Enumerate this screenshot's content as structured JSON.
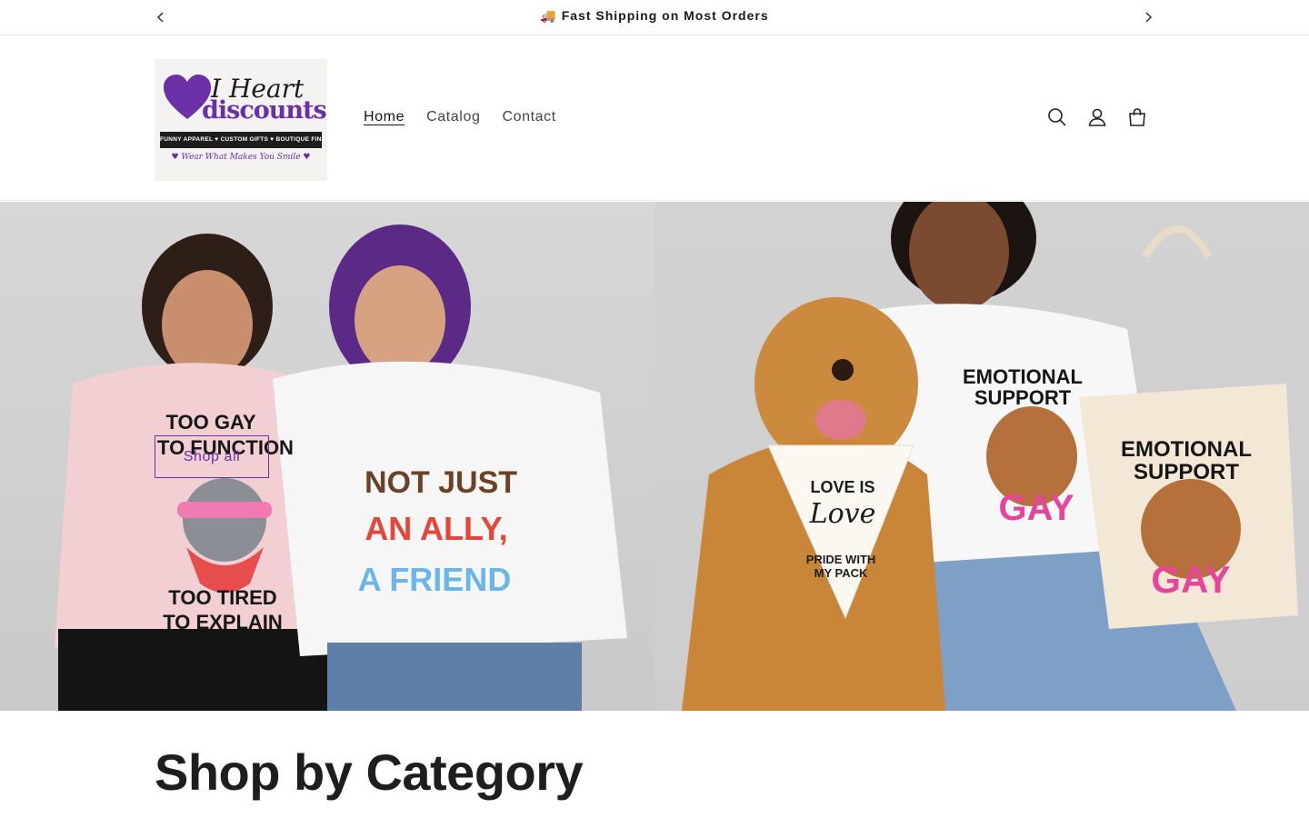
{
  "announcement": {
    "text": "🚚 Fast Shipping on Most Orders",
    "prev_icon": "chevron-left-icon",
    "next_icon": "chevron-right-icon"
  },
  "header": {
    "logo": {
      "line1": "I Heart",
      "line2": "discounts",
      "ribbon": "FUNNY APPAREL ♥ CUSTOM GIFTS ♥ BOUTIQUE FINDS",
      "tagline": "♥ Wear What Makes You Smile ♥"
    },
    "nav": [
      {
        "label": "Home",
        "active": true
      },
      {
        "label": "Catalog",
        "active": false
      },
      {
        "label": "Contact",
        "active": false
      }
    ],
    "icons": [
      "search-icon",
      "account-icon",
      "cart-icon"
    ]
  },
  "hero": {
    "cta_label": "Shop all",
    "left_shirt_1": {
      "line1": "TOO GAY",
      "line2": "TO FUNCTION",
      "line3": "TOO TIRED",
      "line4": "TO EXPLAIN"
    },
    "left_shirt_2": {
      "line1": "NOT JUST",
      "line2": "AN ALLY,",
      "line3": "A FRIEND"
    },
    "bandana": {
      "line1": "LOVE IS",
      "line2": "Love",
      "line3": "PRIDE WITH",
      "line4": "MY PACK"
    },
    "right_shirt": {
      "line1": "EMOTIONAL",
      "line2": "SUPPORT",
      "line3": "GAY"
    },
    "tote": {
      "line1": "EMOTIONAL",
      "line2": "SUPPORT",
      "line3": "GAY"
    }
  },
  "section": {
    "title": "Shop by Category"
  },
  "colors": {
    "brand_purple": "#6b2fa8",
    "text": "#121212"
  }
}
